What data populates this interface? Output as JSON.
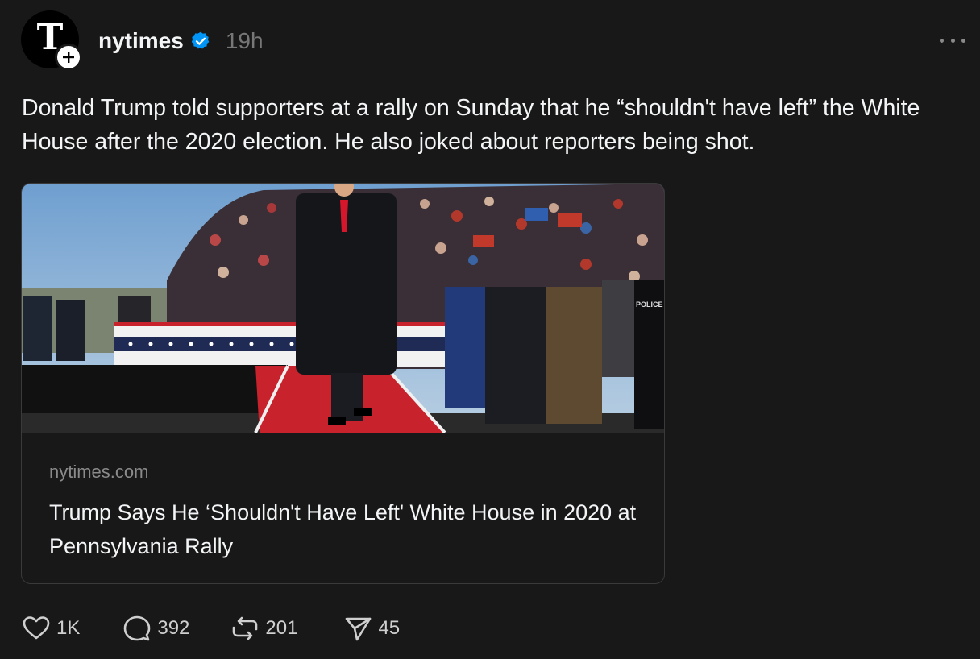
{
  "author": {
    "username": "nytimes",
    "timestamp": "19h",
    "avatar_glyph": "T",
    "verified": true
  },
  "post": {
    "text": "Donald Trump told supporters at a rally on Sunday that he “shouldn't have left” the White House after the 2020 election. He also joked about reporters being shot."
  },
  "link_card": {
    "domain": "nytimes.com",
    "title": "Trump Says He ‘Shouldn't Have Left' White House in 2020 at Pennsylvania Rally",
    "image_alt_text": "POLICE"
  },
  "actions": {
    "likes": "1K",
    "replies": "392",
    "reposts": "201",
    "shares": "45"
  },
  "colors": {
    "background": "#181818",
    "text_primary": "#f3f5f7",
    "text_secondary": "#777777",
    "verified_blue": "#0095f6",
    "carpet_red": "#c8232c"
  }
}
